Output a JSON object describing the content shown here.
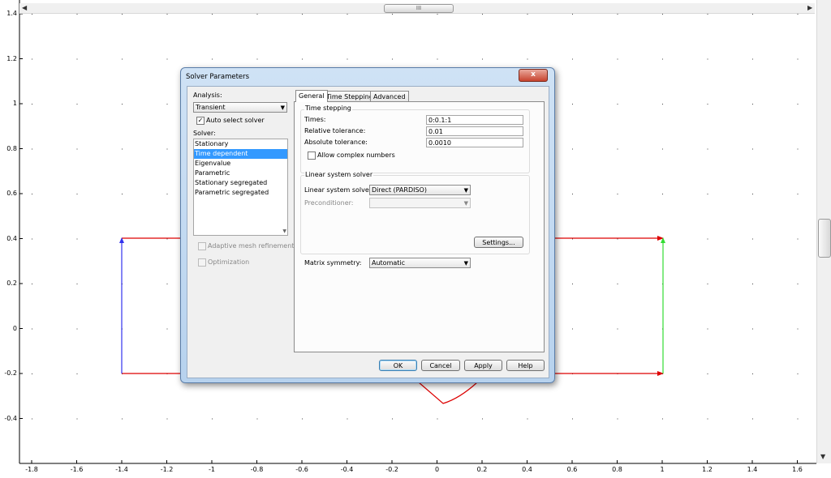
{
  "plot": {
    "y_ticks": [
      "1.4",
      "1.2",
      "1",
      "0.8",
      "0.6",
      "0.4",
      "0.2",
      "0",
      "-0.2",
      "-0.4"
    ],
    "x_ticks": [
      "-1.8",
      "-1.6",
      "-1.4",
      "-1.2",
      "-1",
      "-0.8",
      "-0.6",
      "-0.4",
      "-0.2",
      "0",
      "0.2",
      "0.4",
      "0.6",
      "0.8",
      "1",
      "1.2",
      "1.4",
      "1.6"
    ],
    "scroll_thumb_label": "III",
    "colors": {
      "red": "#dd0000",
      "blue": "#3333ee",
      "green": "#33dd33"
    }
  },
  "dialog": {
    "title": "Solver Parameters",
    "close_label": "x",
    "analysis_label": "Analysis:",
    "analysis_value": "Transient",
    "auto_select_label": "Auto select solver",
    "solver_label": "Solver:",
    "solvers": [
      "Stationary",
      "Time dependent",
      "Eigenvalue",
      "Parametric",
      "Stationary segregated",
      "Parametric segregated"
    ],
    "adaptive_label": "Adaptive mesh refinement",
    "optimization_label": "Optimization",
    "tabs": [
      "General",
      "Time Stepping",
      "Advanced"
    ],
    "time_stepping": {
      "group_label": "Time stepping",
      "times_label": "Times:",
      "times_value": "0:0.1:1",
      "rel_tol_label": "Relative tolerance:",
      "rel_tol_value": "0.01",
      "abs_tol_label": "Absolute tolerance:",
      "abs_tol_value": "0.0010",
      "complex_label": "Allow complex numbers"
    },
    "linear": {
      "group_label": "Linear system solver",
      "solver_label": "Linear system solver:",
      "solver_value": "Direct (PARDISO)",
      "precond_label": "Preconditioner:",
      "precond_value": "",
      "settings_label": "Settings..."
    },
    "matrix_label": "Matrix symmetry:",
    "matrix_value": "Automatic",
    "buttons": {
      "ok": "OK",
      "cancel": "Cancel",
      "apply": "Apply",
      "help": "Help"
    }
  }
}
